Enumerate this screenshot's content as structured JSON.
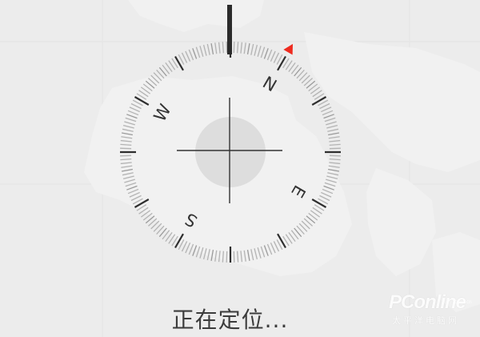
{
  "compass": {
    "cardinals": [
      {
        "label": "N",
        "bearing": 0
      },
      {
        "label": "E",
        "bearing": 90
      },
      {
        "label": "S",
        "bearing": 180
      },
      {
        "label": "W",
        "bearing": 270
      }
    ],
    "dial_rotation_deg": 30,
    "heading_marker_color": "#2b2b2b",
    "north_indicator_color": "#ee2b1f"
  },
  "status": {
    "text": "正在定位..."
  },
  "watermark": {
    "brand": "PConline",
    "domain": ".com.cn",
    "subtitle": "太平洋电脑网"
  }
}
